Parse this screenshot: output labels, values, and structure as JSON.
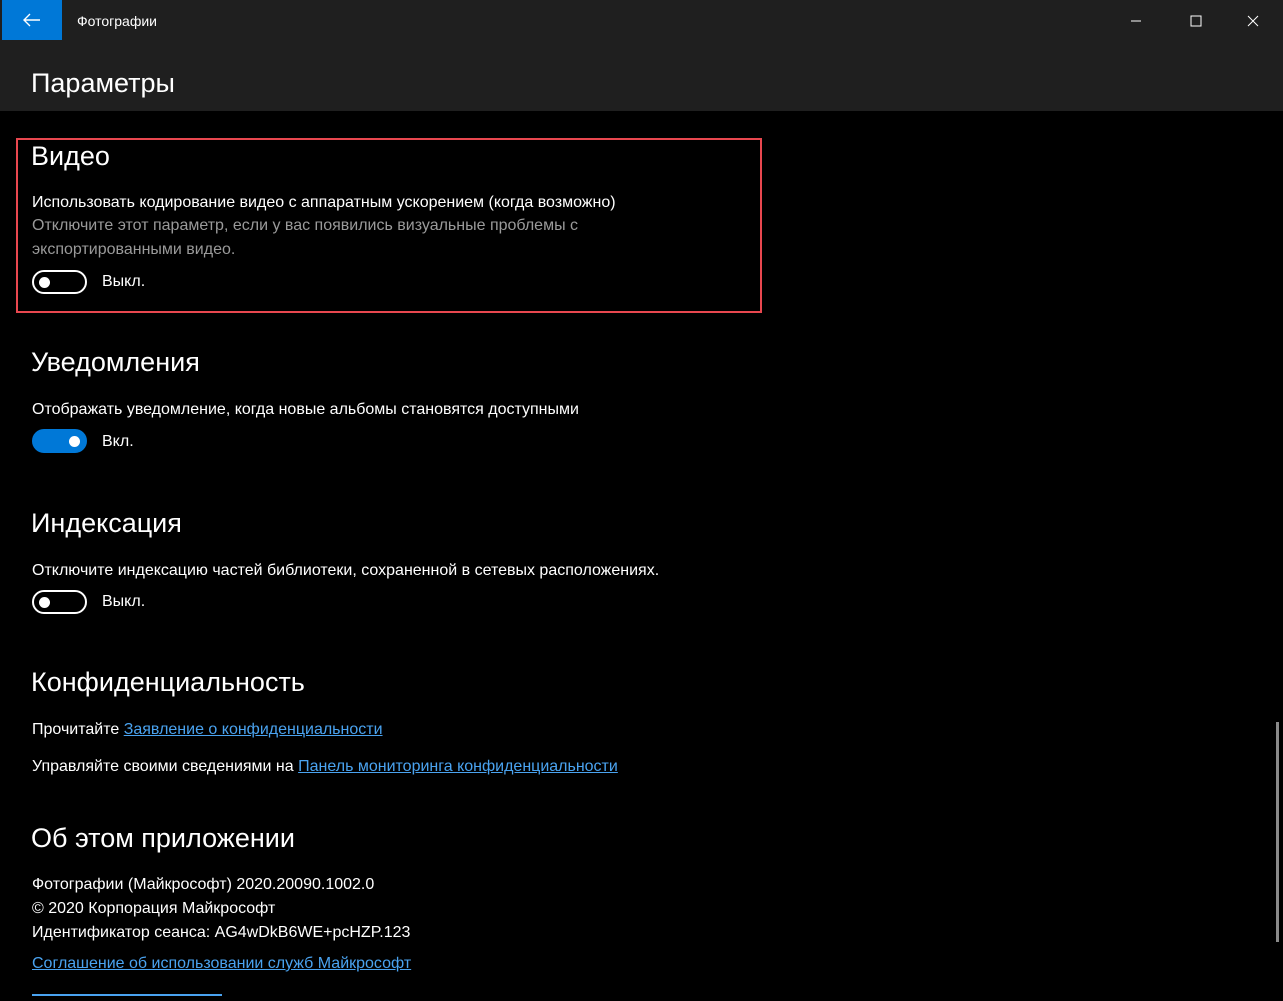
{
  "window": {
    "app_title": "Фотографии",
    "page_title": "Параметры",
    "accent_color": "#0078d7",
    "highlight_color": "#e8474f"
  },
  "icons": {
    "back": "back-arrow-icon",
    "minimize": "minimize-icon",
    "maximize": "maximize-icon",
    "close": "close-icon"
  },
  "video": {
    "title": "Видео",
    "setting": "Использовать кодирование видео с аппаратным ускорением (когда возможно)",
    "hint": "Отключите этот параметр, если у вас появились визуальные проблемы с экспортированными видео.",
    "toggle_state": "off",
    "toggle_label": "Выкл."
  },
  "notifications": {
    "title": "Уведомления",
    "setting": "Отображать уведомление, когда новые альбомы становятся доступными",
    "toggle_state": "on",
    "toggle_label": "Вкл."
  },
  "indexing": {
    "title": "Индексация",
    "setting": "Отключите индексацию частей библиотеки, сохраненной в сетевых расположениях.",
    "toggle_state": "off",
    "toggle_label": "Выкл."
  },
  "privacy": {
    "title": "Конфиденциальность",
    "read_prefix": "Прочитайте",
    "statement_link": "Заявление о конфиденциальности",
    "manage_prefix": "Управляйте своими сведениями на",
    "dashboard_link": "Панель мониторинга конфиденциальности"
  },
  "about": {
    "title": "Об этом приложении",
    "version": "Фотографии (Майкрософт) 2020.20090.1002.0",
    "copyright": "© 2020 Корпорация Майкрософт",
    "session_id": "Идентификатор сеанса: AG4wDkB6WE+pcHZP.123",
    "services_link": "Соглашение об использовании служб Майкрософт"
  }
}
